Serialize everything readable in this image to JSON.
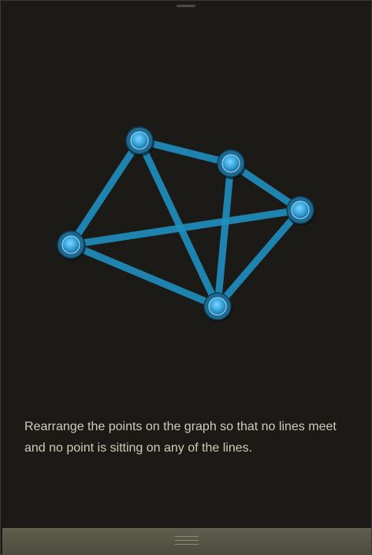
{
  "puzzle": {
    "node_color": "#3aa7de",
    "edge_color": "#1f8fbf",
    "nodes": [
      {
        "id": "a",
        "col": 176,
        "row": 177
      },
      {
        "id": "b",
        "col": 292,
        "row": 206
      },
      {
        "id": "c",
        "col": 380,
        "row": 265
      },
      {
        "id": "d",
        "col": 89,
        "row": 309
      },
      {
        "id": "e",
        "col": 275,
        "row": 387
      }
    ],
    "edges": [
      [
        "a",
        "b"
      ],
      [
        "a",
        "d"
      ],
      [
        "a",
        "e"
      ],
      [
        "b",
        "c"
      ],
      [
        "b",
        "e"
      ],
      [
        "c",
        "d"
      ],
      [
        "c",
        "e"
      ],
      [
        "d",
        "e"
      ]
    ]
  },
  "instructions": {
    "text": "Rearrange the points on the graph so that no lines meet and no point is sitting on any of the lines."
  },
  "bottom_bar": {
    "icon": "menu-icon"
  }
}
